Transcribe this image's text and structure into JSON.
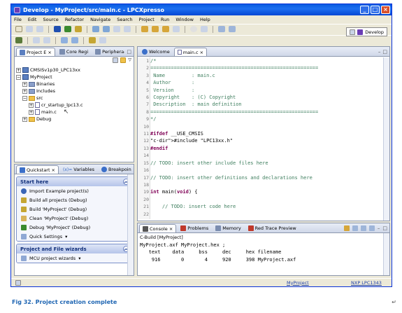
{
  "window": {
    "title": "Develop - MyProject/src/main.c - LPCXpresso"
  },
  "menu": [
    "File",
    "Edit",
    "Source",
    "Refactor",
    "Navigate",
    "Search",
    "Project",
    "Run",
    "Window",
    "Help"
  ],
  "perspective": {
    "label": "Develop"
  },
  "left_tabs": [
    "Project E",
    "Core Regi",
    "Periphera"
  ],
  "project_tree": [
    {
      "label": "CMSISv1p30_LPC13xx",
      "depth": 0
    },
    {
      "label": "MyProject",
      "depth": 0
    },
    {
      "label": "Binaries",
      "depth": 1
    },
    {
      "label": "Includes",
      "depth": 1
    },
    {
      "label": "src",
      "depth": 1
    },
    {
      "label": "cr_startup_lpc13.c",
      "depth": 2
    },
    {
      "label": "main.c",
      "depth": 2
    },
    {
      "label": "Debug",
      "depth": 1
    }
  ],
  "quickstart_tabs": [
    "Quickstart",
    "Variables",
    "Breakpoin"
  ],
  "quickstart": {
    "start_here": "Start here",
    "items": [
      "Import Example project(s)",
      "Build all projects (Debug)",
      "Build 'MyProject' (Debug)",
      "Clean 'MyProject' (Debug)",
      "Debug 'MyProject' (Debug)",
      "Quick Settings"
    ],
    "wizards": "Project and File wizards",
    "wizard_item": "MCU project wizards"
  },
  "editor_tabs": [
    "Welcome",
    "main.c"
  ],
  "editor_gutter": [
    "1",
    "2",
    "3",
    "4",
    "5",
    "6",
    "7",
    "8",
    "9",
    "10",
    "11",
    "12",
    "13",
    "14",
    "15",
    "16",
    "17",
    "18",
    "19",
    "20",
    "21",
    "22"
  ],
  "editor_lines": [
    "/*",
    "=========================================================",
    " Name         : main.c",
    " Author       :",
    " Version      :",
    " Copyright    : (C) Copyright",
    " Description  : main definition",
    "=========================================================",
    "*/",
    "",
    "#ifdef __USE_CMSIS",
    "#include \"LPC13xx.h\"",
    "#endif",
    "",
    "// TODO: insert other include files here",
    "",
    "// TODO: insert other definitions and declarations here",
    "",
    "int main(void) {",
    "",
    "    // TODO: insert code here",
    ""
  ],
  "console_tabs": [
    "Console",
    "Problems",
    "Memory",
    "Red Trace Preview"
  ],
  "console": {
    "header": "C-Build [MyProject]",
    "lines": [
      "MyProject.axf MyProject.hex ;",
      "   text    data     bss     dec     hex filename",
      "    916       0       4     920     398 MyProject.axf"
    ]
  },
  "status": {
    "project": "MyProject",
    "target": "NXP LPC1343"
  },
  "caption": "Fig 32.  Project creation complete",
  "pilcrow": "↵"
}
